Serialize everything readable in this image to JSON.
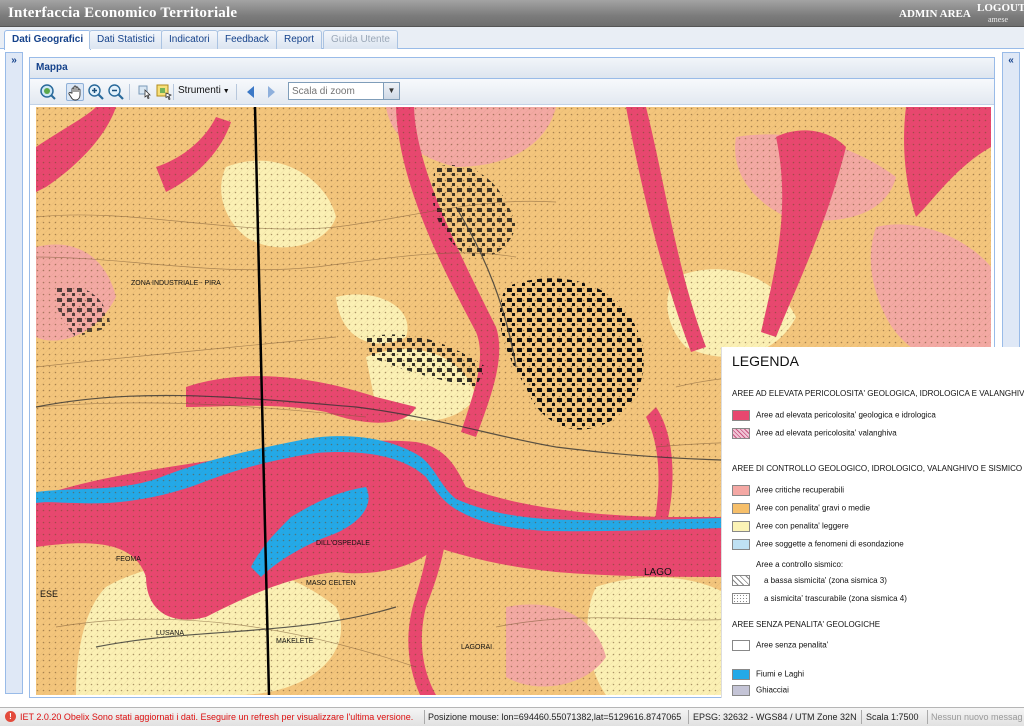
{
  "header": {
    "title": "Interfaccia Economico Territoriale",
    "admin_area": "ADMIN AREA",
    "logout": "LOGOUT",
    "username": "amese"
  },
  "tabs": [
    {
      "label": "Dati Geografici",
      "active": true
    },
    {
      "label": "Dati Statistici"
    },
    {
      "label": "Indicatori"
    },
    {
      "label": "Feedback"
    },
    {
      "label": "Report"
    },
    {
      "label": "Guida Utente",
      "disabled": true
    }
  ],
  "panel": {
    "title": "Mappa",
    "toolbar": {
      "strumenti_label": "Strumenti",
      "zoom_placeholder": "Scala di zoom"
    }
  },
  "legend": {
    "title": "LEGENDA",
    "sections": [
      {
        "heading": "AREE AD ELEVATA PERICOLOSITA' GEOLOGICA, IDROLOGICA E VALANGHIVA",
        "items": [
          {
            "label": "Aree ad elevata pericolosita' geologica e idrologica",
            "color": "#e8476f"
          },
          {
            "label": "Aree ad elevata pericolosita' valanghiva",
            "color": "#f1c5d6"
          }
        ]
      },
      {
        "heading": "AREE DI CONTROLLO GEOLOGICO, IDROLOGICO, VALANGHIVO E SISMICO",
        "items": [
          {
            "label": "Aree critiche recuperabili",
            "color": "#f4a8a4"
          },
          {
            "label": "Aree con penalita' gravi o medie",
            "color": "#f6bf6a"
          },
          {
            "label": "Aree con penalita' leggere",
            "color": "#fbf3b6"
          },
          {
            "label": "Aree soggette a fenomeni di esondazione",
            "color": "#bfe1f3"
          }
        ],
        "seismic_heading": "Aree a controllo sismico:",
        "seismic_items": [
          {
            "label": "a bassa sismicita' (zona sismica 3)"
          },
          {
            "label": "a sismicita' trascurabile (zona sismica 4)"
          }
        ]
      },
      {
        "heading": "AREE SENZA PENALITA' GEOLOGICHE",
        "items": [
          {
            "label": "Aree senza penalita'",
            "color": "#ffffff"
          },
          {
            "label": "Fiumi e Laghi",
            "color": "#23a9e8"
          },
          {
            "label": "Ghiacciai",
            "color": "#c4c4d6"
          }
        ]
      }
    ]
  },
  "map_labels": [
    "ZONA INDUSTRIALE - PIRA",
    "LAGO",
    "MASO CELTEN",
    "LAGORAI",
    "LUSANA",
    "DILL'OSPEDALE",
    "FEOMA",
    "MAKELETE",
    "ESE"
  ],
  "status": {
    "message": "IET 2.0.20 Obelix Sono stati aggiornati i dati. Eseguire un refresh per visualizzare l'ultima versione.",
    "mouse_position": "Posizione mouse: lon=694460.55071382,lat=5129616.8747065",
    "epsg": "EPSG: 32632 - WGS84 / UTM Zone 32N",
    "scale": "Scala 1:7500",
    "new_messages": "Nessun nuovo messag"
  }
}
